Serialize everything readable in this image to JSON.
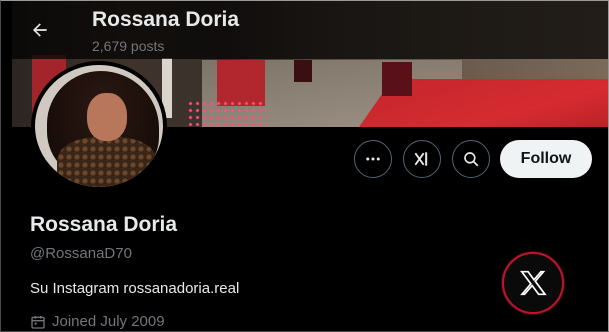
{
  "header": {
    "title": "Rossana Doria",
    "posts_count": "2,679 posts",
    "back_icon": "arrow-left-icon"
  },
  "profile": {
    "display_name": "Rossana Doria",
    "handle": "@RossanaD70",
    "bio": "Su Instagram rossanadoria.real",
    "joined": "Joined July 2009"
  },
  "actions": {
    "more_icon": "more-horizontal-icon",
    "grok_icon": "grok-icon",
    "search_icon": "search-icon",
    "follow_label": "Follow"
  },
  "colors": {
    "background": "#000000",
    "text_primary": "#e7e9ea",
    "text_secondary": "#71767b",
    "follow_bg": "#eff3f4",
    "badge_ring": "#c0142a"
  }
}
